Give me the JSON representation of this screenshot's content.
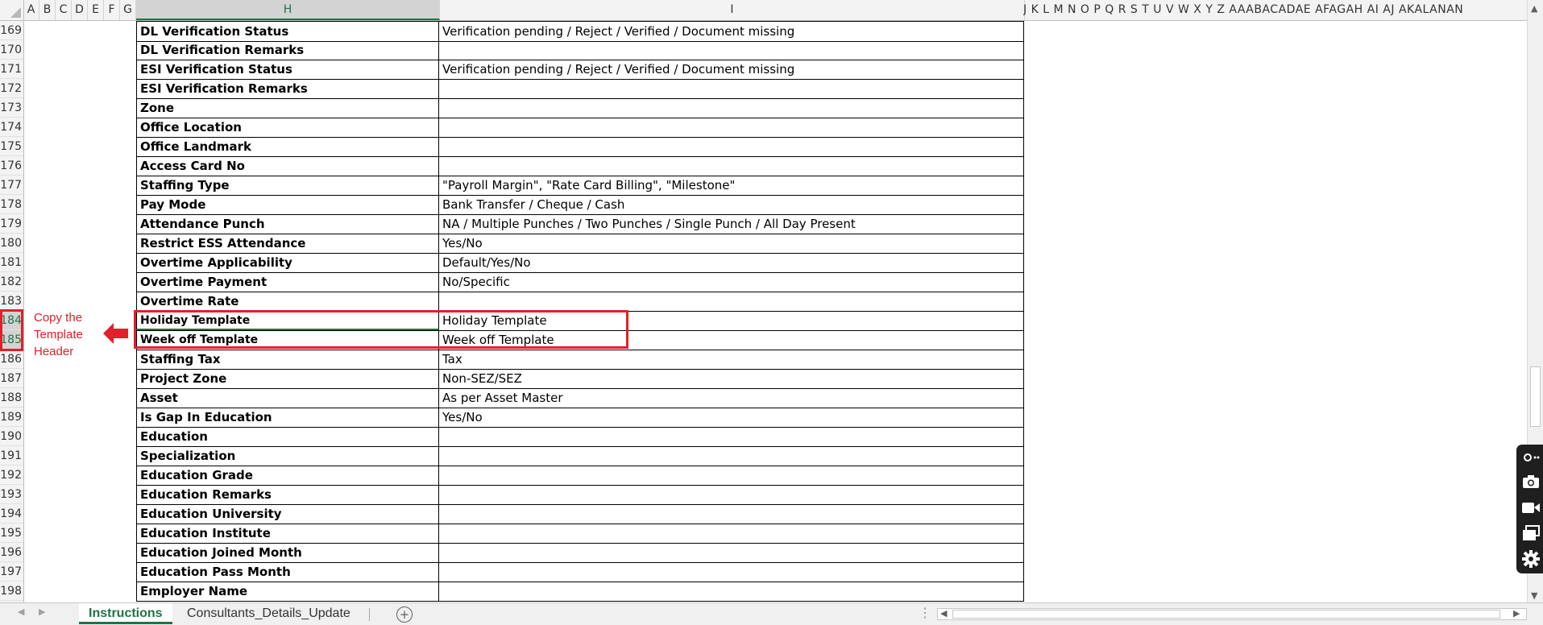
{
  "columns": {
    "left": [
      "A",
      "B",
      "C",
      "D",
      "E",
      "F",
      "G"
    ],
    "h": "H",
    "i": "I",
    "narrow": "J  K  L  M N O  P Q R  S  T  U V W X  Y  Z  AAABACADAE AFAGAH AI AJ AKALANAN"
  },
  "rows": [
    {
      "num": "169",
      "field": "DL Verification Status",
      "value": "Verification pending / Reject / Verified / Document missing"
    },
    {
      "num": "170",
      "field": "DL Verification Remarks",
      "value": ""
    },
    {
      "num": "171",
      "field": "ESI Verification Status",
      "value": "Verification pending / Reject / Verified / Document missing"
    },
    {
      "num": "172",
      "field": "ESI Verification Remarks",
      "value": ""
    },
    {
      "num": "173",
      "field": "Zone",
      "value": ""
    },
    {
      "num": "174",
      "field": "Office Location",
      "value": ""
    },
    {
      "num": "175",
      "field": "Office Landmark",
      "value": ""
    },
    {
      "num": "176",
      "field": "Access Card No",
      "value": ""
    },
    {
      "num": "177",
      "field": "Staffing Type",
      "value": "\"Payroll Margin\", \"Rate Card Billing\", \"Milestone\""
    },
    {
      "num": "178",
      "field": "Pay Mode",
      "value": "Bank Transfer / Cheque / Cash"
    },
    {
      "num": "179",
      "field": "Attendance Punch",
      "value": "NA / Multiple Punches / Two Punches / Single Punch / All Day Present"
    },
    {
      "num": "180",
      "field": "Restrict ESS Attendance",
      "value": "Yes/No"
    },
    {
      "num": "181",
      "field": "Overtime Applicability",
      "value": "Default/Yes/No"
    },
    {
      "num": "182",
      "field": "Overtime Payment",
      "value": "No/Specific"
    },
    {
      "num": "183",
      "field": "Overtime Rate",
      "value": ""
    },
    {
      "num": "184",
      "field": "Holiday Template",
      "value": "Holiday Template"
    },
    {
      "num": "185",
      "field": "Week off Template",
      "value": "Week off Template"
    },
    {
      "num": "186",
      "field": "Staffing Tax",
      "value": "Tax"
    },
    {
      "num": "187",
      "field": "Project Zone",
      "value": "Non-SEZ/SEZ"
    },
    {
      "num": "188",
      "field": "Asset",
      "value": "As per Asset Master"
    },
    {
      "num": "189",
      "field": "Is Gap In Education",
      "value": "Yes/No"
    },
    {
      "num": "190",
      "field": "Education",
      "value": ""
    },
    {
      "num": "191",
      "field": "Specialization",
      "value": ""
    },
    {
      "num": "192",
      "field": "Education Grade",
      "value": ""
    },
    {
      "num": "193",
      "field": "Education Remarks",
      "value": ""
    },
    {
      "num": "194",
      "field": "Education University",
      "value": ""
    },
    {
      "num": "195",
      "field": "Education Institute",
      "value": ""
    },
    {
      "num": "196",
      "field": "Education Joined Month",
      "value": ""
    },
    {
      "num": "197",
      "field": "Education Pass Month",
      "value": ""
    },
    {
      "num": "198",
      "field": "Employer Name",
      "value": ""
    }
  ],
  "annotation": {
    "text": "Copy the Template Header",
    "color": "#e0202a"
  },
  "tabs": [
    {
      "label": "Instructions",
      "active": true
    },
    {
      "label": "Consultants_Details_Update",
      "active": false
    }
  ],
  "add_sheet_symbol": "+",
  "colors": {
    "accent": "#217346",
    "annotation": "#e0202a"
  },
  "icons": [
    "camera-icon",
    "video-icon",
    "screens-icon",
    "gear-icon",
    "pin-icon"
  ]
}
